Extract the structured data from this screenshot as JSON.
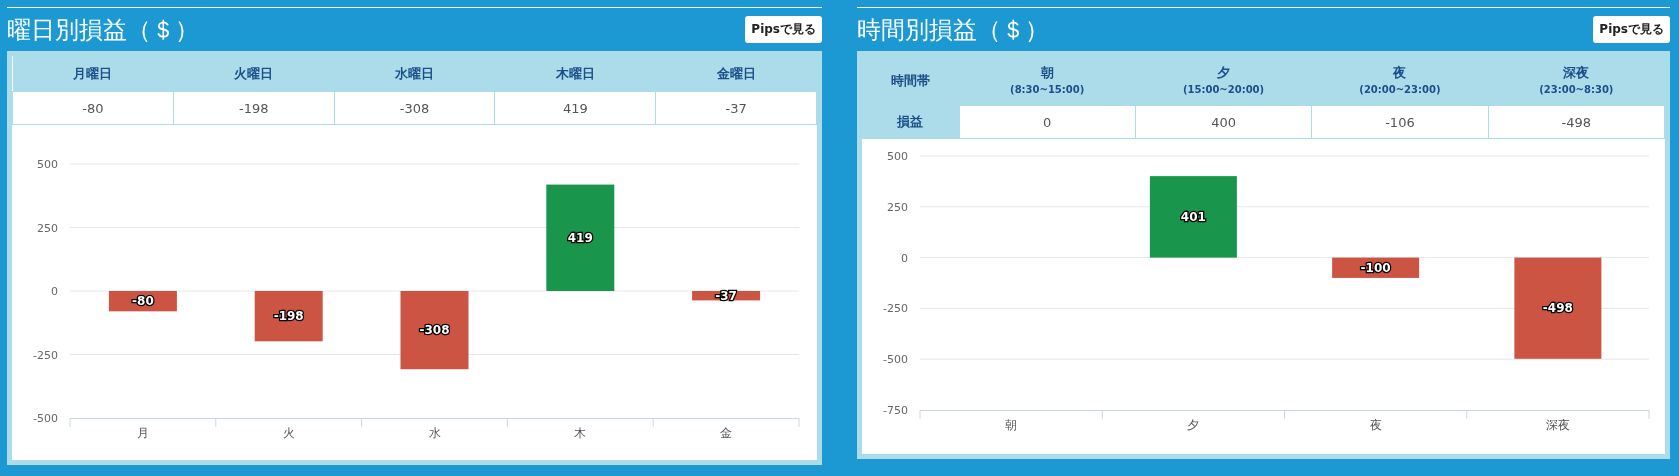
{
  "sections": [
    {
      "title": "曜日別損益（＄）",
      "button": "Pipsで見る",
      "table": {
        "columns": [
          {
            "label": "月曜日"
          },
          {
            "label": "火曜日"
          },
          {
            "label": "水曜日"
          },
          {
            "label": "木曜日"
          },
          {
            "label": "金曜日"
          }
        ],
        "values": [
          "-80",
          "-198",
          "-308",
          "419",
          "-37"
        ]
      },
      "chart_data": {
        "type": "bar",
        "categories": [
          "月",
          "火",
          "水",
          "木",
          "金"
        ],
        "stacked": true,
        "grid": true,
        "ylim": [
          -500,
          500
        ],
        "yticks": [
          -500,
          -250,
          0,
          250,
          500
        ],
        "series": [
          {
            "color": "#1a964c",
            "values": [
              null,
              null,
              null,
              419,
              null
            ],
            "value_labels": [
              null,
              null,
              null,
              "419",
              null
            ]
          },
          {
            "color": "#cc5443",
            "values": [
              -80,
              -198,
              -308,
              null,
              -37
            ],
            "value_labels": [
              "-80",
              "-198",
              "-308",
              null,
              "-37"
            ]
          }
        ]
      }
    },
    {
      "title": "時間別損益（＄）",
      "button": "Pipsで見る",
      "table": {
        "corner": "時間帯",
        "row_label": "損益",
        "columns": [
          {
            "label": "朝",
            "sublabel": "(8:30~15:00)"
          },
          {
            "label": "夕",
            "sublabel": "(15:00~20:00)"
          },
          {
            "label": "夜",
            "sublabel": "(20:00~23:00)"
          },
          {
            "label": "深夜",
            "sublabel": "(23:00~8:30)"
          }
        ],
        "values": [
          "0",
          "400",
          "-106",
          "-498"
        ]
      },
      "chart_data": {
        "type": "bar",
        "categories": [
          "朝",
          "夕",
          "夜",
          "深夜"
        ],
        "stacked": true,
        "grid": true,
        "ylim": [
          -750,
          500
        ],
        "yticks": [
          -750,
          -500,
          -250,
          0,
          250,
          500
        ],
        "series": [
          {
            "color": "#1a964c",
            "values": [
              null,
              401,
              null,
              null
            ],
            "value_labels": [
              null,
              "401",
              null,
              null
            ]
          },
          {
            "color": "#cc5443",
            "values": [
              null,
              null,
              -100,
              -498
            ],
            "value_labels": [
              null,
              null,
              "-100",
              "-498"
            ]
          }
        ]
      }
    }
  ]
}
